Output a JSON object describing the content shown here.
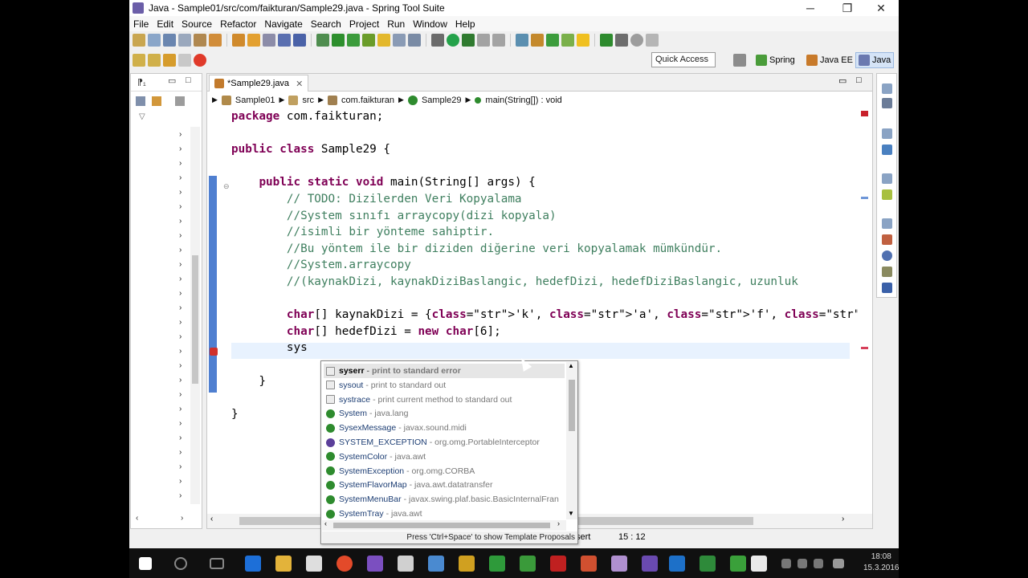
{
  "window": {
    "title": "Java - Sample01/src/com/faikturan/Sample29.java - Spring Tool Suite",
    "minimize": "─",
    "maximize": "❐",
    "close": "✕"
  },
  "menubar": [
    "File",
    "Edit",
    "Source",
    "Refactor",
    "Navigate",
    "Search",
    "Project",
    "Run",
    "Window",
    "Help"
  ],
  "toolbar": {
    "quick_access": "Quick Access",
    "perspectives": [
      "Spring",
      "Java EE",
      "Java"
    ]
  },
  "editor": {
    "tab_label": "*Sample29.java",
    "tab_close": "✕",
    "breadcrumb": [
      "Sample01",
      "src",
      "com.faikturan",
      "Sample29",
      "main(String[]) : void"
    ],
    "code_lines": [
      "package com.faikturan;",
      "",
      "public class Sample29 {",
      "",
      "    public static void main(String[] args) {",
      "        // TODO: Dizilerden Veri Kopyalama",
      "        //System sınıfı arraycopy(dizi kopyala)",
      "        //isimli bir yönteme sahiptir.",
      "        //Bu yöntem ile bir diziden diğerine veri kopyalamak mümkündür.",
      "        //System.arraycopy",
      "        //(kaynakDizi, kaynakDiziBaslangic, hedefDizi, hedefDiziBaslangic, uzunluk",
      "",
      "        char[] kaynakDizi = {'k', 'a', 'f', 'e', 'i','n', 's', 'i', 'z'};",
      "        char[] hedefDizi = new char[6];",
      "        sys",
      "",
      "    }",
      "",
      "}"
    ]
  },
  "completion": {
    "items": [
      {
        "name": "syserr",
        "desc": "- print to standard error",
        "kind": "template",
        "selected": true
      },
      {
        "name": "sysout",
        "desc": "- print to standard out",
        "kind": "template",
        "selected": false
      },
      {
        "name": "systrace",
        "desc": "- print current method to standard out",
        "kind": "template",
        "selected": false
      },
      {
        "name": "System",
        "desc": "- java.lang",
        "kind": "class",
        "selected": false
      },
      {
        "name": "SysexMessage",
        "desc": "- javax.sound.midi",
        "kind": "class",
        "selected": false
      },
      {
        "name": "SYSTEM_EXCEPTION",
        "desc": "- org.omg.PortableInterceptor",
        "kind": "interface",
        "selected": false
      },
      {
        "name": "SystemColor",
        "desc": "- java.awt",
        "kind": "class",
        "selected": false
      },
      {
        "name": "SystemException",
        "desc": "- org.omg.CORBA",
        "kind": "class",
        "selected": false
      },
      {
        "name": "SystemFlavorMap",
        "desc": "- java.awt.datatransfer",
        "kind": "class",
        "selected": false
      },
      {
        "name": "SystemMenuBar",
        "desc": "- javax.swing.plaf.basic.BasicInternalFran",
        "kind": "class",
        "selected": false
      },
      {
        "name": "SystemTray",
        "desc": "- java.awt",
        "kind": "class",
        "selected": false
      }
    ],
    "footer": "Press 'Ctrl+Space' to show Template Proposals"
  },
  "statusbar": {
    "insert": "sert",
    "position": "15 : 12"
  },
  "taskbar": {
    "time": "18:08",
    "date": "15.3.2016"
  }
}
